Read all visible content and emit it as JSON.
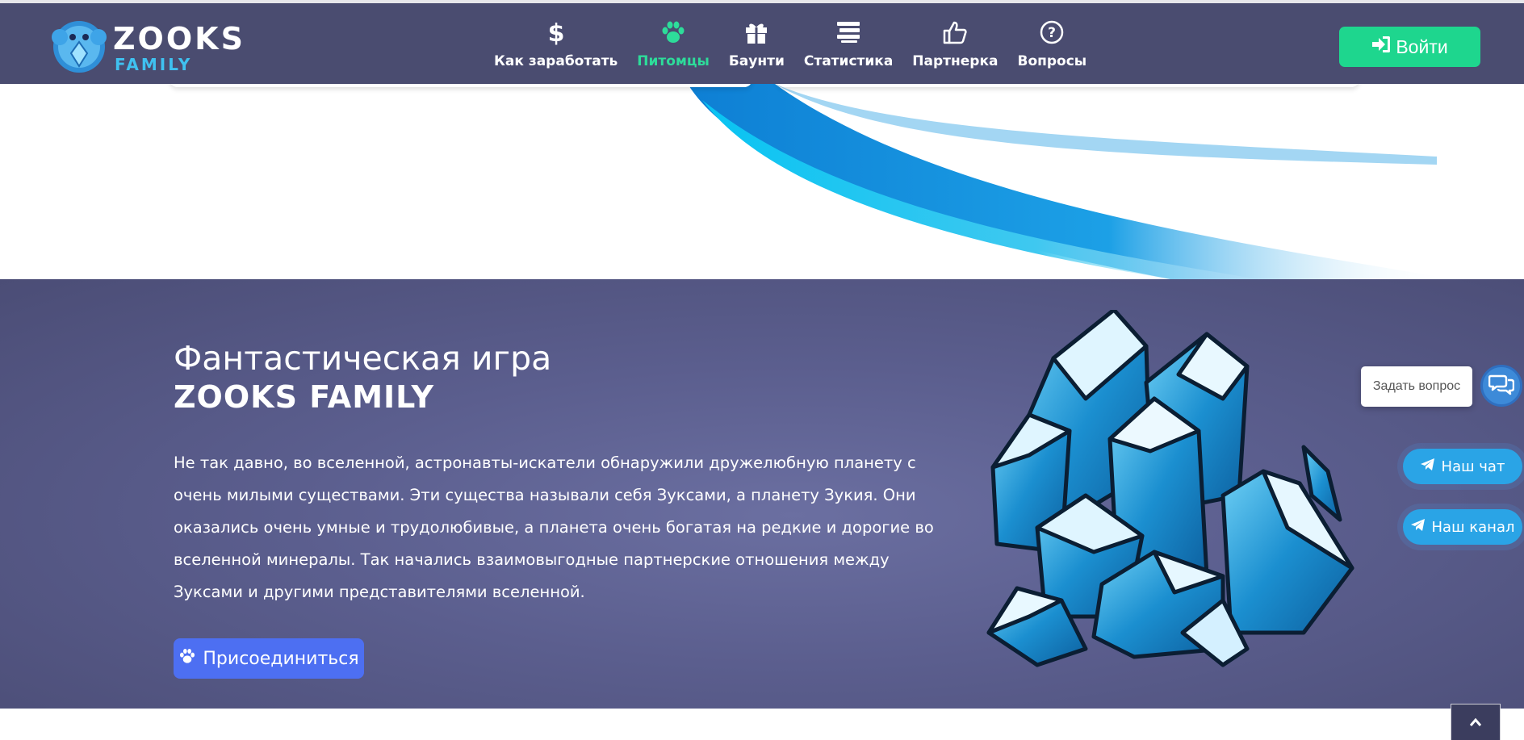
{
  "header": {
    "logo": {
      "line1": "ZOOKS",
      "line2": "FAMILY"
    },
    "nav": [
      {
        "label": "Как заработать",
        "icon": "dollar-icon",
        "active": false
      },
      {
        "label": "Питомцы",
        "icon": "paw-icon",
        "active": true
      },
      {
        "label": "Баунти",
        "icon": "gift-icon",
        "active": false
      },
      {
        "label": "Статистика",
        "icon": "bars-icon",
        "active": false
      },
      {
        "label": "Партнерка",
        "icon": "thumbs-up-icon",
        "active": false
      },
      {
        "label": "Вопросы",
        "icon": "question-circle-icon",
        "active": false
      }
    ],
    "login_label": "Войти",
    "login_icon": "sign-in-icon"
  },
  "hero": {
    "title_line1": "Фантастическая игра",
    "title_line2": "ZOOKS FAMILY",
    "description": "Не так давно, во вселенной, астронавты-искатели обнаружили дружелюбную планету с очень милыми существами. Эти существа называли себя Зуксами, а планету Зукия. Они оказались очень умные и трудолюбивые, а планета очень богатая на редкие и дорогие во вселенной минералы. Так начались взаимовыгодные партнерские отношения между Зуксами и другими представителями вселенной.",
    "join_label": "Присоединиться",
    "join_icon": "paw-icon"
  },
  "widgets": {
    "ask_question": "Задать вопрос",
    "chat_icon": "comments-icon",
    "telegram_chat": "Наш чат",
    "telegram_channel": "Наш канал",
    "telegram_icon": "paper-plane-icon",
    "scroll_top_icon": "chevron-up-icon"
  },
  "colors": {
    "header_bg": "#4a4c70",
    "active_nav": "#2ddc9a",
    "login_btn": "#1ed68e",
    "join_btn": "#4d6ff2",
    "telegram": "#2aa4e6"
  }
}
